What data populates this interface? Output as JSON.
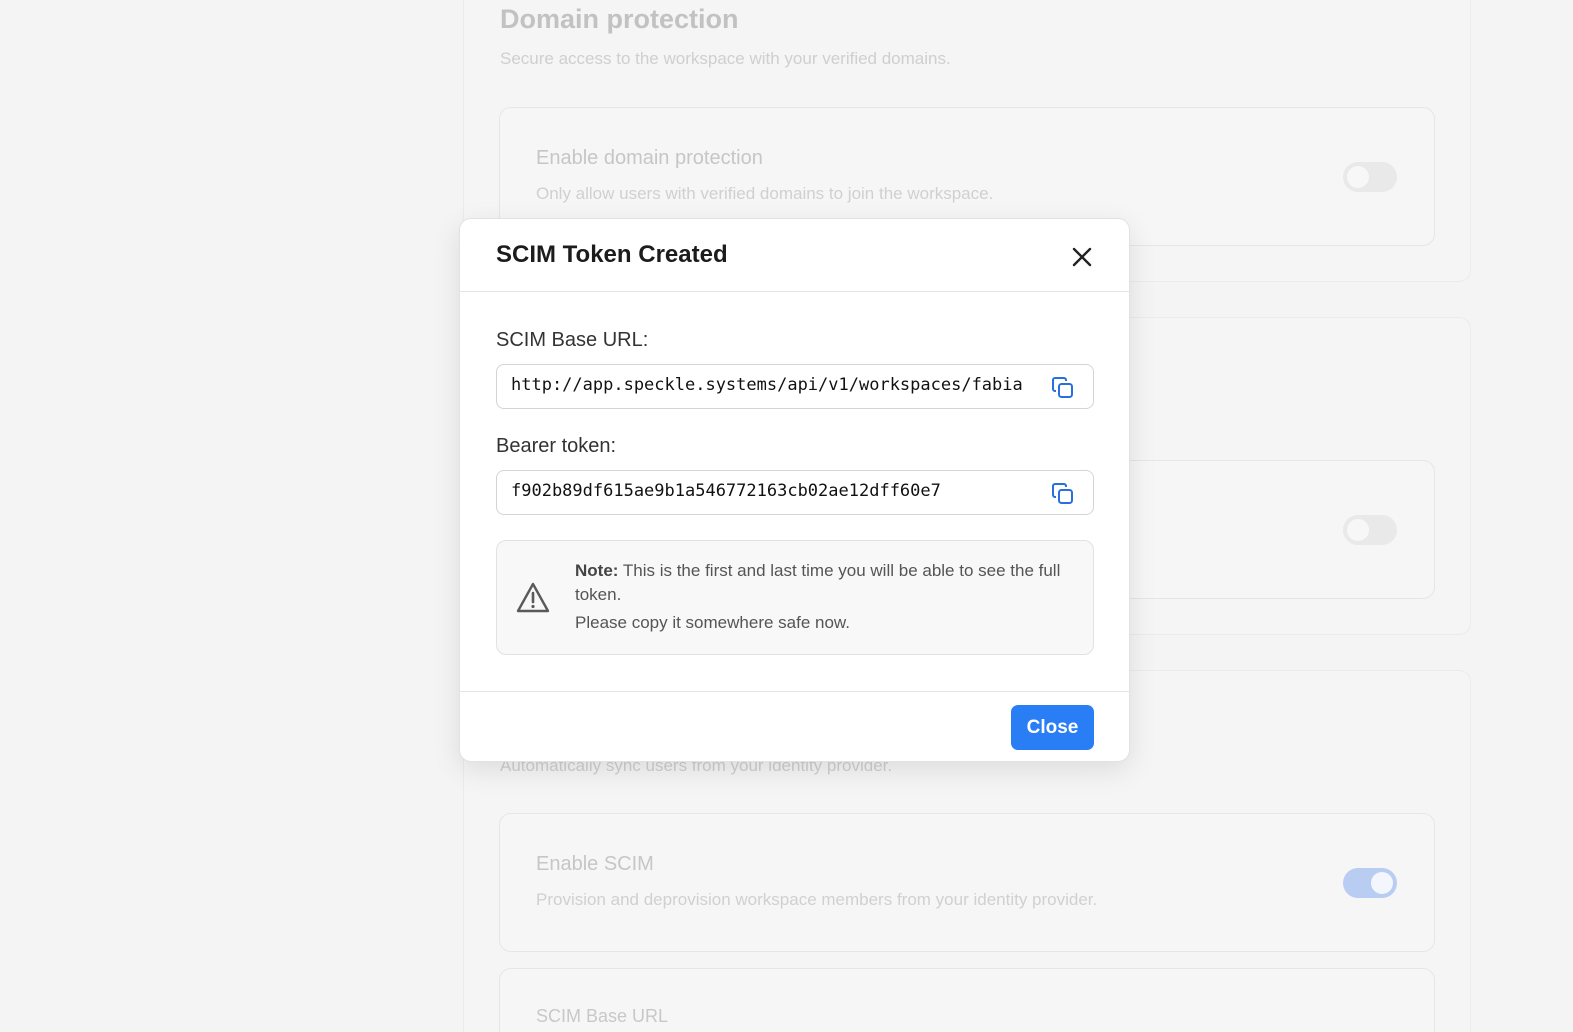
{
  "background": {
    "domain_section": {
      "title": "Domain protection",
      "description": "Secure access to the workspace with your verified domains.",
      "item_title": "Enable domain protection",
      "item_description": "Only allow users with verified domains to join the workspace."
    },
    "scim_section": {
      "description": "Automatically sync users from your identity provider.",
      "item_title": "Enable SCIM",
      "item_description": "Provision and deprovision workspace members from your identity provider.",
      "base_url_label": "SCIM Base URL"
    }
  },
  "modal": {
    "title": "SCIM Token Created",
    "base_url_label": "SCIM Base URL:",
    "base_url_value": "http://app.speckle.systems/api/v1/workspaces/fabia",
    "bearer_label": "Bearer token:",
    "bearer_value": "f902b89df615ae9b1a546772163cb02ae12dff60e7",
    "note_bold": "Note:",
    "note_text": " This is the first and last time you will be able to see the full token.",
    "note_sub": "Please copy it somewhere safe now.",
    "close_label": "Close"
  },
  "icons": {
    "close": "close-icon",
    "copy": "copy-icon",
    "warning": "warning-triangle-icon"
  },
  "colors": {
    "accent": "#2a7ef5",
    "toggle_on": "#b9cdf3"
  }
}
